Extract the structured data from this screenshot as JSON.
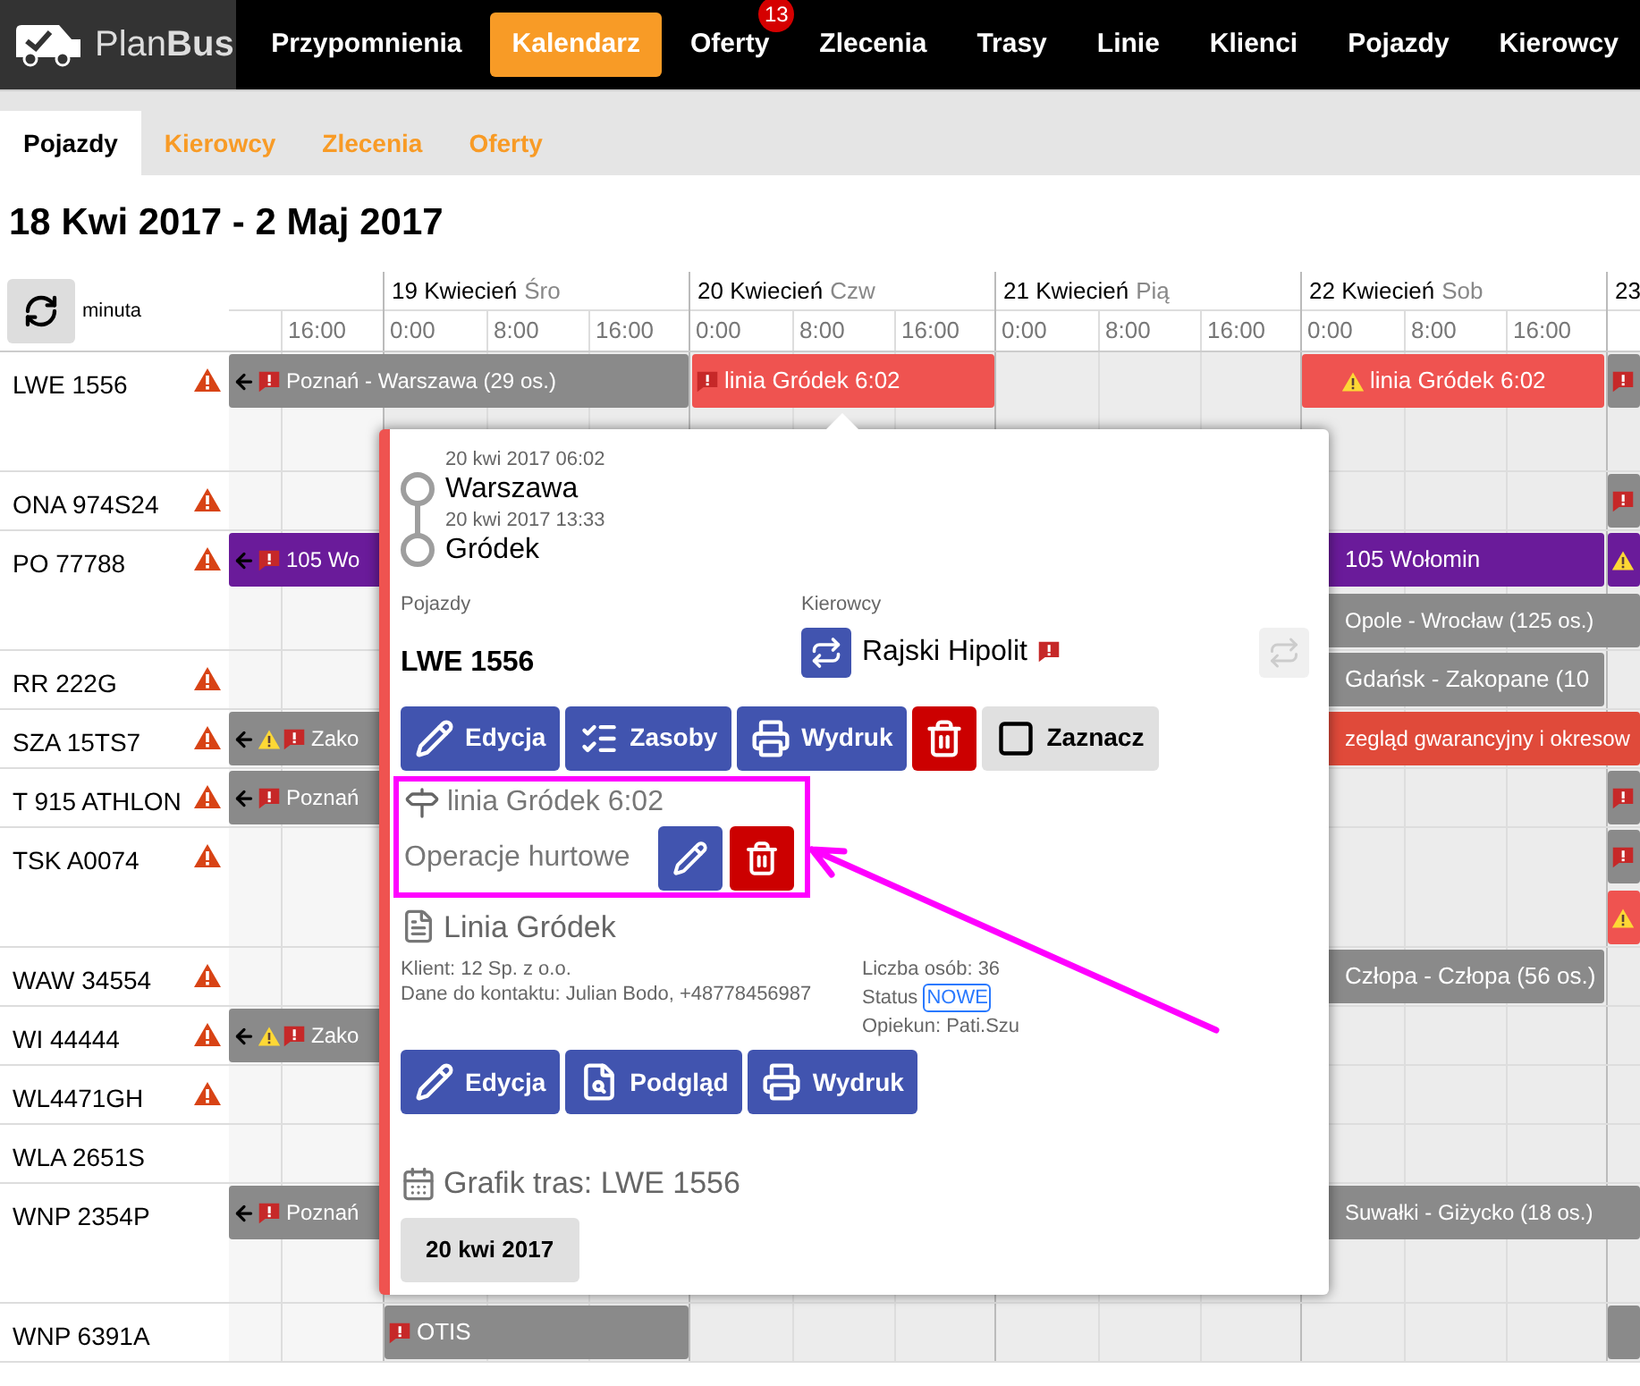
{
  "logo": {
    "text": "Plan**Bus**"
  },
  "nav": [
    {
      "label": "Przypomnienia",
      "selected": false
    },
    {
      "label": "Kalendarz",
      "selected": true
    },
    {
      "label": "Oferty",
      "selected": false,
      "badge": "13"
    },
    {
      "label": "Zlecenia",
      "selected": false
    },
    {
      "label": "Trasy",
      "selected": false
    },
    {
      "label": "Linie",
      "selected": false
    },
    {
      "label": "Klienci",
      "selected": false
    },
    {
      "label": "Pojazdy",
      "selected": false
    },
    {
      "label": "Kierowcy",
      "selected": false
    }
  ],
  "subtabs": [
    {
      "label": "Pojazdy",
      "selected": true
    },
    {
      "label": "Kierowcy",
      "selected": false
    },
    {
      "label": "Zlecenia",
      "selected": false
    },
    {
      "label": "Oferty",
      "selected": false
    }
  ],
  "range_title": "18 Kwi 2017 - 2 Maj 2017",
  "scale_label": "minuta",
  "days": [
    {
      "hours": [
        "16:00"
      ]
    },
    {
      "date": "19 Kwiecień",
      "weekday": "Śro",
      "hours": [
        "0:00",
        "8:00",
        "16:00"
      ]
    },
    {
      "date": "20 Kwiecień",
      "weekday": "Czw",
      "hours": [
        "0:00",
        "8:00",
        "16:00"
      ]
    },
    {
      "date": "21 Kwiecień",
      "weekday": "Pią",
      "hours": [
        "0:00",
        "8:00",
        "16:00"
      ]
    },
    {
      "date": "22 Kwiecień",
      "weekday": "Sob",
      "hours": [
        "0:00",
        "8:00",
        "16:00"
      ]
    },
    {
      "date": "23"
    }
  ],
  "vehicles": [
    {
      "plate": "LWE 1556",
      "warning": true,
      "events": [
        {
          "title": "Poznań - Warszawa (29 os.)",
          "color": "#8a8a8a",
          "icons": [
            {
              "kind": "back"
            },
            {
              "kind": "comment"
            }
          ]
        },
        {
          "title": "linia Gródek 6:02",
          "color": "#ef5350",
          "icons": [
            {
              "kind": "comment"
            }
          ]
        },
        {
          "title": "linia Gródek 6:02",
          "color": "#ef5350",
          "icons": [
            {
              "kind": "warning"
            }
          ]
        },
        {
          "color": "#8a8a8a",
          "icons": [
            {
              "kind": "comment"
            }
          ]
        }
      ]
    },
    {
      "plate": "ONA 974S24",
      "warning": true,
      "events": [
        {
          "color": "#8a8a8a",
          "icons": [
            {
              "kind": "comment"
            }
          ]
        }
      ]
    },
    {
      "plate": "PO 77788",
      "warning": true,
      "events": [
        {
          "title": "105 Wo",
          "color": "#6a1b9a",
          "icons": [
            {
              "kind": "back"
            },
            {
              "kind": "comment"
            }
          ]
        },
        {
          "title": "105 Wołomin",
          "color": "#6a1b9a"
        },
        {
          "color": "#6a1b9a",
          "icons": [
            {
              "kind": "warning"
            }
          ]
        },
        {
          "title": "Opole - Wrocław (125 os.)",
          "color": "#8a8a8a"
        }
      ]
    },
    {
      "plate": "RR 222G",
      "warning": true,
      "events": [
        {
          "title": "Gdańsk - Zakopane (10",
          "color": "#8a8a8a"
        }
      ]
    },
    {
      "plate": "SZA 15TS7",
      "warning": true,
      "events": [
        {
          "title": "Zako",
          "color": "#8a8a8a",
          "icons": [
            {
              "kind": "back"
            },
            {
              "kind": "warning"
            },
            {
              "kind": "comment"
            }
          ]
        },
        {
          "title": "zegląd gwarancyjny i okresow",
          "color": "#e04a3a"
        }
      ]
    },
    {
      "plate": "T 915 ATHLON",
      "warning": true,
      "events": [
        {
          "title": "Poznań",
          "color": "#8a8a8a",
          "icons": [
            {
              "kind": "back"
            },
            {
              "kind": "comment"
            }
          ]
        },
        {
          "color": "#8a8a8a",
          "icons": [
            {
              "kind": "comment"
            }
          ]
        }
      ]
    },
    {
      "plate": "TSK A0074",
      "warning": true,
      "events": [
        {
          "color": "#8a8a8a",
          "icons": [
            {
              "kind": "comment"
            }
          ]
        },
        {
          "color": "#ef5350",
          "icons": [
            {
              "kind": "warning"
            }
          ]
        }
      ]
    },
    {
      "plate": "WAW 34554",
      "warning": true,
      "events": [
        {
          "title": "Człopa - Człopa (56 os.)",
          "color": "#8a8a8a"
        }
      ]
    },
    {
      "plate": "WI 44444",
      "warning": true,
      "events": [
        {
          "title": "Zako",
          "color": "#8a8a8a",
          "icons": [
            {
              "kind": "back"
            },
            {
              "kind": "warning"
            },
            {
              "kind": "comment"
            }
          ]
        }
      ]
    },
    {
      "plate": "WL4471GH",
      "warning": true
    },
    {
      "plate": "WLA 2651S",
      "warning": false
    },
    {
      "plate": "WNP 2354P",
      "warning": false,
      "events": [
        {
          "title": "Poznań",
          "color": "#8a8a8a",
          "icons": [
            {
              "kind": "back"
            },
            {
              "kind": "comment"
            }
          ]
        },
        {
          "title": "Suwałki - Giżycko (18 os.)",
          "color": "#8a8a8a"
        }
      ]
    },
    {
      "plate": "WNP 6391A",
      "warning": false,
      "events": [
        {
          "title": "OTIS",
          "color": "#8a8a8a",
          "icons": [
            {
              "kind": "comment"
            }
          ]
        },
        {
          "color": "#8a8a8a"
        }
      ]
    }
  ],
  "popup": {
    "stops": [
      {
        "time": "20 kwi 2017 06:02",
        "place": "Warszawa"
      },
      {
        "time": "20 kwi 2017 13:33",
        "place": "Gródek"
      }
    ],
    "vehicle_label": "Pojazdy",
    "vehicle": "LWE 1556",
    "driver_label": "Kierowcy",
    "driver": "Rajski Hipolit",
    "actions": [
      {
        "kind": "edit",
        "label": "Edycja"
      },
      {
        "kind": "resources",
        "label": "Zasoby"
      },
      {
        "kind": "print",
        "label": "Wydruk"
      },
      {
        "kind": "delete"
      },
      {
        "kind": "select",
        "label": "Zaznacz"
      }
    ],
    "operation": {
      "title": "linia Gródek 6:02",
      "type": "Operacje hurtowe",
      "actions": [
        {
          "kind": "edit"
        },
        {
          "kind": "delete"
        }
      ]
    },
    "order": {
      "title": "Linia Gródek",
      "client": "Klient: 12 Sp. z o.o.",
      "contact": "Dane do kontaktu: Julian Bodo, +48778456987",
      "persons": "Liczba osób: 36",
      "status_label": "Status",
      "status": "NOWE",
      "manager": "Opiekun: Pati.Szu",
      "actions": [
        {
          "kind": "edit",
          "label": "Edycja"
        },
        {
          "kind": "preview",
          "label": "Podgląd"
        },
        {
          "kind": "print",
          "label": "Wydruk"
        }
      ]
    },
    "schedule": {
      "title": "Grafik tras: LWE 1556",
      "dates": [
        "20 kwi 2017"
      ]
    }
  }
}
